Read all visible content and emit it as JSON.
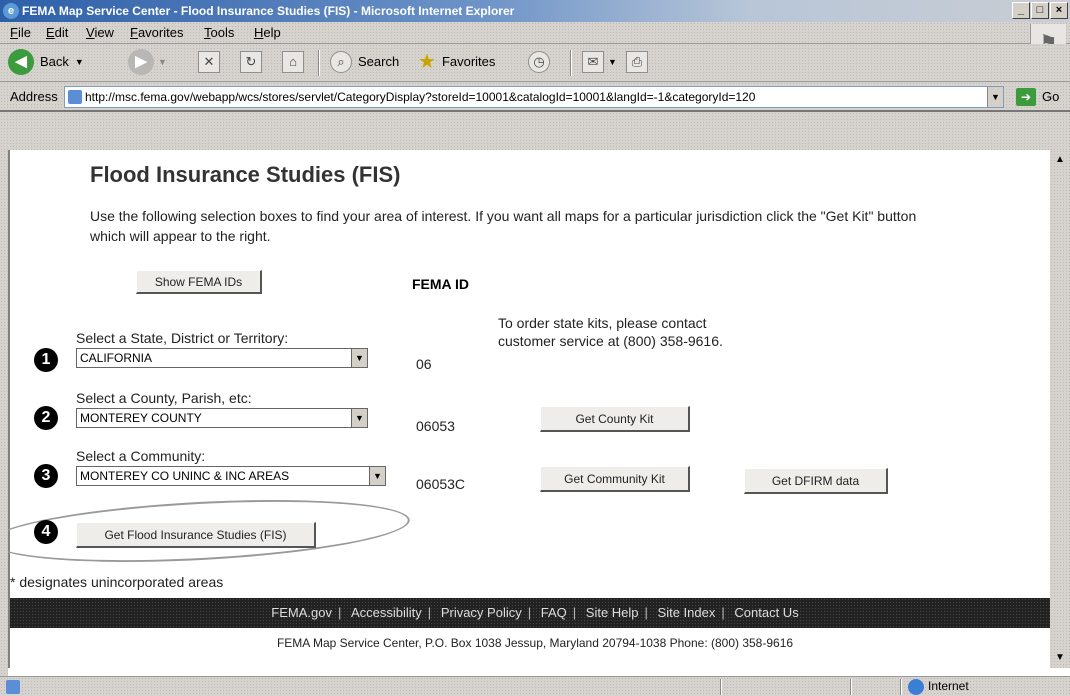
{
  "window": {
    "title": "FEMA Map Service Center - Flood Insurance Studies (FIS) - Microsoft Internet Explorer"
  },
  "menu": [
    "File",
    "Edit",
    "View",
    "Favorites",
    "Tools",
    "Help"
  ],
  "toolbar": {
    "back_label": "Back",
    "search_label": "Search",
    "favorites_label": "Favorites"
  },
  "address": {
    "label": "Address",
    "url": "http://msc.fema.gov/webapp/wcs/stores/servlet/CategoryDisplay?storeId=10001&catalogId=10001&langId=-1&categoryId=120",
    "go_label": "Go"
  },
  "page": {
    "title": "Flood Insurance Studies (FIS)",
    "instructions": "Use the following selection boxes to find your area of interest. If you want all maps for a particular jurisdiction click the \"Get Kit\" button which will appear to the right.",
    "show_ids_button": "Show FEMA IDs",
    "fema_id_header": "FEMA ID",
    "step1": {
      "number": "1",
      "label": "Select a State, District or Territory:",
      "value": "CALIFORNIA",
      "id": "06"
    },
    "state_note": "To order state kits, please contact customer service at (800) 358-9616.",
    "step2": {
      "number": "2",
      "label": "Select a County, Parish, etc:",
      "value": "MONTEREY COUNTY",
      "id": "06053",
      "button": "Get County Kit"
    },
    "step3": {
      "number": "3",
      "label": "Select a Community:",
      "value": "MONTEREY CO UNINC & INC AREAS",
      "id": "06053C",
      "button": "Get Community Kit",
      "dfirm_button": "Get DFIRM data"
    },
    "step4": {
      "number": "4",
      "button": "Get Flood Insurance Studies (FIS)"
    },
    "footnote": "* designates unincorporated areas",
    "footer_links": [
      "FEMA.gov",
      "Accessibility",
      "Privacy Policy",
      "FAQ",
      "Site Help",
      "Site Index",
      "Contact Us"
    ],
    "contact": "FEMA Map Service Center, P.O. Box 1038 Jessup, Maryland 20794-1038 Phone: (800) 358-9616"
  },
  "status": {
    "zone": "Internet"
  }
}
